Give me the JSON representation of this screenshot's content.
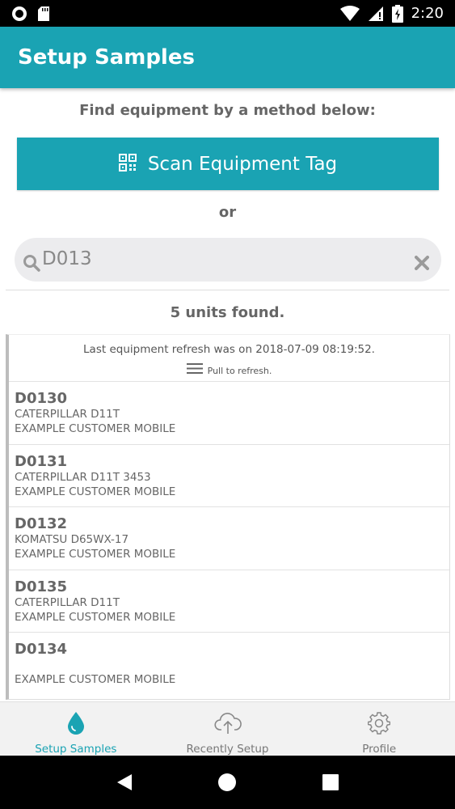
{
  "status_bar": {
    "time": "2:20"
  },
  "app_bar": {
    "title": "Setup Samples"
  },
  "finder": {
    "instruction": "Find equipment by a method below:",
    "scan_button_label": "Scan Equipment Tag",
    "or_label": "or"
  },
  "search": {
    "value": "D013"
  },
  "results": {
    "count_label": "5 units found.",
    "refresh_info": "Last equipment refresh was on 2018-07-09 08:19:52.",
    "pull_hint": "Pull to refresh.",
    "units": [
      {
        "id": "D0130",
        "model": "CATERPILLAR D11T",
        "customer": "EXAMPLE CUSTOMER MOBILE"
      },
      {
        "id": "D0131",
        "model": "CATERPILLAR D11T 3453",
        "customer": "EXAMPLE CUSTOMER MOBILE"
      },
      {
        "id": "D0132",
        "model": "KOMATSU D65WX-17",
        "customer": "EXAMPLE CUSTOMER MOBILE"
      },
      {
        "id": "D0135",
        "model": "CATERPILLAR D11T",
        "customer": "EXAMPLE CUSTOMER MOBILE"
      },
      {
        "id": "D0134",
        "model": "",
        "customer": "EXAMPLE CUSTOMER MOBILE"
      }
    ]
  },
  "bottom_nav": {
    "items": [
      {
        "label": "Setup Samples",
        "icon": "water-drop-icon",
        "active": true
      },
      {
        "label": "Recently Setup",
        "icon": "cloud-upload-icon",
        "active": false
      },
      {
        "label": "Profile",
        "icon": "gear-icon",
        "active": false
      }
    ]
  },
  "colors": {
    "primary": "#1aa3b3",
    "background": "#ffffff",
    "text": "#666666"
  }
}
